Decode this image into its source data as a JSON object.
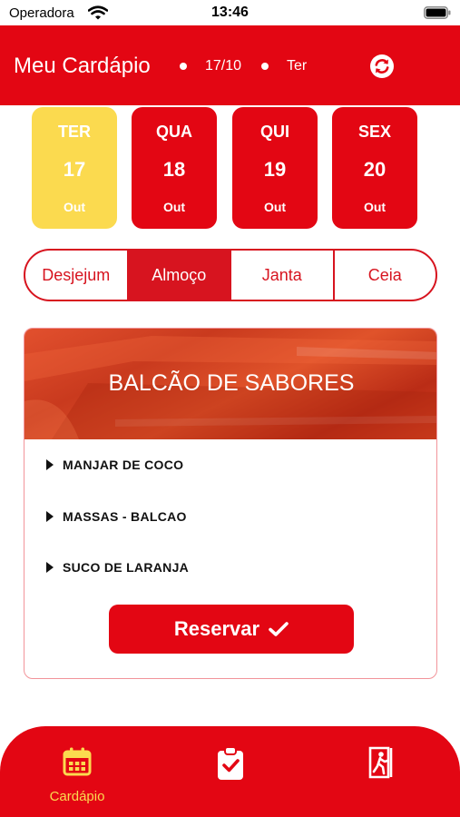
{
  "status_bar": {
    "carrier": "Operadora",
    "time": "13:46"
  },
  "header": {
    "title": "Meu Cardápio",
    "date": "17/10",
    "weekday": "Ter"
  },
  "days": [
    {
      "abbr": "TER",
      "num": "17",
      "month": "Out",
      "selected": true
    },
    {
      "abbr": "QUA",
      "num": "18",
      "month": "Out",
      "selected": false
    },
    {
      "abbr": "QUI",
      "num": "19",
      "month": "Out",
      "selected": false
    },
    {
      "abbr": "SEX",
      "num": "20",
      "month": "Out",
      "selected": false
    }
  ],
  "meal_tabs": [
    {
      "label": "Desjejum",
      "active": false
    },
    {
      "label": "Almoço",
      "active": true
    },
    {
      "label": "Janta",
      "active": false
    },
    {
      "label": "Ceia",
      "active": false
    }
  ],
  "menu": {
    "station": "BALCÃO DE SABORES",
    "items": [
      "MANJAR DE COCO",
      "MASSAS - BALCAO",
      "SUCO DE LARANJA"
    ],
    "reserve_label": "Reservar"
  },
  "tab_bar": {
    "items": [
      {
        "label": "Cardápio",
        "icon": "calendar-icon",
        "active": true
      },
      {
        "label": "",
        "icon": "clipboard-check-icon",
        "active": false
      },
      {
        "label": "",
        "icon": "exit-icon",
        "active": false
      }
    ]
  },
  "colors": {
    "primary": "#e30613",
    "accent": "#fbda4f",
    "text": "#111111"
  }
}
